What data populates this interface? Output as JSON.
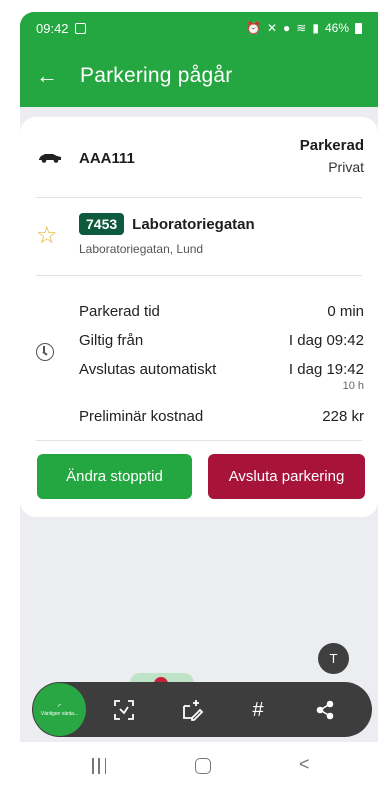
{
  "status_bar": {
    "time": "09:42",
    "battery": "46%"
  },
  "app_bar": {
    "title": "Parkering pågår"
  },
  "vehicle": {
    "plate": "AAA111",
    "status": "Parkerad",
    "type": "Privat"
  },
  "zone": {
    "code": "7453",
    "name": "Laboratoriegatan",
    "address": "Laboratoriegatan, Lund"
  },
  "details": [
    {
      "label": "Parkerad tid",
      "value": "0 min",
      "sub": ""
    },
    {
      "label": "Giltig från",
      "value": "I dag 09:42",
      "sub": ""
    },
    {
      "label": "Avslutas automatiskt",
      "value": "I dag 19:42",
      "sub": "10 h"
    },
    {
      "label": "Preliminär kostnad",
      "value": "228 kr",
      "sub": ""
    }
  ],
  "buttons": {
    "change_stop": "Ändra stopptid",
    "end_parking": "Avsluta parkering"
  },
  "overlay": {
    "badge_text": "Vänligen vänta...",
    "text_fab": "T"
  },
  "colors": {
    "brand_green": "#24a641",
    "end_red": "#a8133a",
    "zone_badge": "#0e5a3e",
    "star": "#e8b52a"
  },
  "icons": [
    "arrow-left-icon",
    "car-icon",
    "star-icon",
    "clock-icon",
    "text-recognition-icon",
    "scan-icon",
    "edit-capture-icon",
    "hashtag-icon",
    "share-icon"
  ]
}
